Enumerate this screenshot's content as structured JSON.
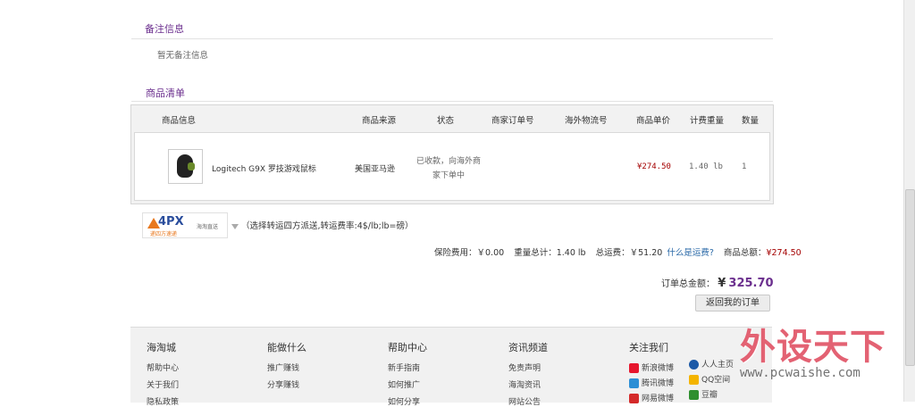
{
  "remarks": {
    "title": "备注信息",
    "text": "暂无备注信息"
  },
  "products": {
    "title": "商品清单",
    "headers": [
      "商品信息",
      "商品来源",
      "状态",
      "商家订单号",
      "海外物流号",
      "商品单价",
      "计费重量",
      "数量"
    ],
    "rows": [
      {
        "name": "Logitech G9X 罗技游戏鼠标",
        "source": "美国亚马逊",
        "status_line1": "已收款，向海外商",
        "status_line2": "家下单中",
        "merchant_order": "",
        "tracking": "",
        "price": "¥274.50",
        "weight": "1.40 lb",
        "qty": "1"
      }
    ]
  },
  "shipping": {
    "logo_text": "4PX",
    "logo_sub": "递四方速递",
    "logo_tag": "海淘直送",
    "selector_icon": "dropdown-triangle-icon",
    "note": "（选择转运四方派送,转运费率:4$/lb;lb=磅）"
  },
  "summary": {
    "insurance_label": "保险费用：",
    "insurance_value": "￥0.00",
    "weight_label": "重量总计：",
    "weight_value": "1.40 lb",
    "freight_label": "总运费：",
    "freight_value": "￥51.20",
    "freight_link": "什么是运费?",
    "goods_label": "商品总额：",
    "goods_value": "¥274.50",
    "total_label": "订单总金额：",
    "total_currency": "¥",
    "total_value": "325.70"
  },
  "back_button": "返回我的订单",
  "footer": {
    "cols": [
      {
        "title": "海淘城",
        "links": [
          "帮助中心",
          "关于我们",
          "隐私政策"
        ]
      },
      {
        "title": "能做什么",
        "links": [
          "推广赚钱",
          "分享赚钱"
        ]
      },
      {
        "title": "帮助中心",
        "links": [
          "新手指南",
          "如何推广",
          "如何分享"
        ]
      },
      {
        "title": "资讯频道",
        "links": [
          "免责声明",
          "海淘资讯",
          "网站公告"
        ]
      }
    ],
    "follow": {
      "title": "关注我们",
      "left": [
        "新浪微博",
        "腾讯微博",
        "网易微博"
      ],
      "right": [
        "人人主页",
        "QQ空间",
        "豆瓣"
      ]
    }
  },
  "watermark": {
    "brand": "外设天下",
    "url": "www.pcwaishe.com"
  },
  "colors": {
    "accent": "#6b2f8e",
    "price_red": "#a40000",
    "link_blue": "#2b6aa8"
  }
}
